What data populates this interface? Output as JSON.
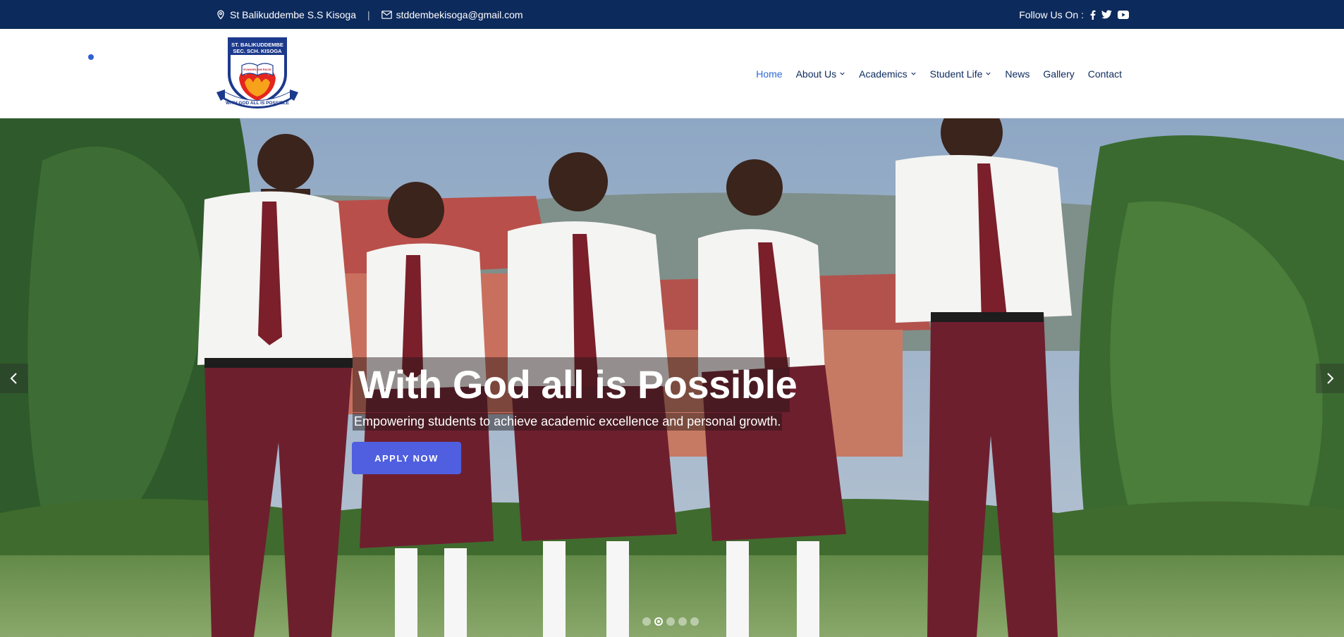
{
  "topbar": {
    "school_name": "St Balikuddembe S.S Kisoga",
    "separator": "|",
    "email": "stddembekisoga@gmail.com",
    "follow_label": "Follow Us On :",
    "social_icons": [
      "facebook-icon",
      "twitter-icon",
      "youtube-icon"
    ]
  },
  "logo": {
    "line1": "ST. BALIKUDDEMBE",
    "line2": "SEC. SCH. KISOGA",
    "book_text": "EVANGELIUM PACIS",
    "motto": "WITH GOD ALL IS POSSIBLE"
  },
  "nav": {
    "items": [
      {
        "label": "Home",
        "active": true,
        "dropdown": false
      },
      {
        "label": "About Us",
        "active": false,
        "dropdown": true
      },
      {
        "label": "Academics",
        "active": false,
        "dropdown": true
      },
      {
        "label": "Student Life",
        "active": false,
        "dropdown": true
      },
      {
        "label": "News",
        "active": false,
        "dropdown": false
      },
      {
        "label": "Gallery",
        "active": false,
        "dropdown": false
      },
      {
        "label": "Contact",
        "active": false,
        "dropdown": false
      }
    ]
  },
  "hero": {
    "headline": "With God all is Possible",
    "subline": "Empowering students to achieve academic excellence and personal growth.",
    "cta_label": "APPLY NOW",
    "slide_count": 5,
    "active_slide": 2
  },
  "colors": {
    "topbar_bg": "#0d2a5c",
    "nav_text": "#0d2a5c",
    "nav_active": "#2e6bd6",
    "cta_bg": "#4f5fe0",
    "uniform_trousers": "#6e1f2e"
  }
}
